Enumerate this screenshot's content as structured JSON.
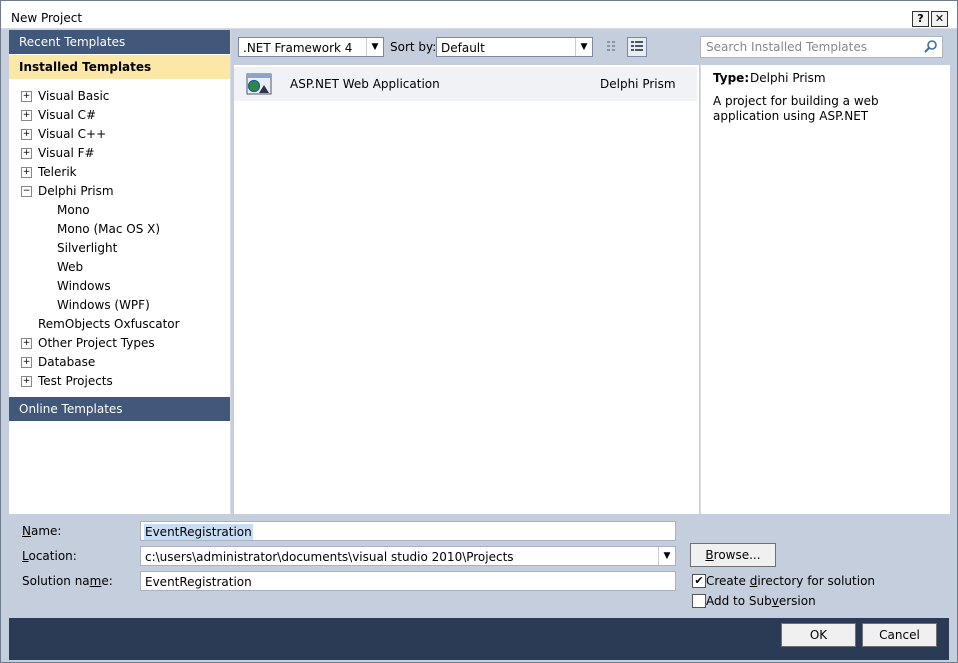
{
  "window": {
    "title": "New Project",
    "help_label": "?",
    "close_label": "✕"
  },
  "sidebar": {
    "recent_label": "Recent Templates",
    "installed_label": "Installed Templates",
    "online_label": "Online Templates",
    "items": [
      {
        "label": "Visual Basic",
        "expander": "+"
      },
      {
        "label": "Visual C#",
        "expander": "+"
      },
      {
        "label": "Visual C++",
        "expander": "+"
      },
      {
        "label": "Visual F#",
        "expander": "+"
      },
      {
        "label": "Telerik",
        "expander": "+"
      },
      {
        "label": "Delphi Prism",
        "expander": "−"
      },
      {
        "label": "Mono",
        "expander": ""
      },
      {
        "label": "Mono (Mac OS X)",
        "expander": ""
      },
      {
        "label": "Silverlight",
        "expander": ""
      },
      {
        "label": "Web",
        "expander": ""
      },
      {
        "label": "Windows",
        "expander": ""
      },
      {
        "label": "Windows (WPF)",
        "expander": ""
      },
      {
        "label": "RemObjects Oxfuscator",
        "expander": ""
      },
      {
        "label": "Other Project Types",
        "expander": "+"
      },
      {
        "label": "Database",
        "expander": "+"
      },
      {
        "label": "Test Projects",
        "expander": "+"
      }
    ]
  },
  "toolbar": {
    "framework_value": ".NET Framework 4",
    "sortby_label": "Sort by:",
    "sort_value": "Default",
    "search_placeholder": "Search Installed Templates"
  },
  "templates": [
    {
      "name": "ASP.NET Web Application",
      "language": "Delphi Prism"
    }
  ],
  "details": {
    "type_label": "Type:",
    "type_value": "Delphi Prism",
    "description": "A project for building a web application using ASP.NET"
  },
  "form": {
    "name_label": "Name:",
    "name_value": "EventRegistration",
    "location_label": "Location:",
    "location_value": "c:\\users\\administrator\\documents\\visual studio 2010\\Projects",
    "solution_label": "Solution name:",
    "solution_value": "EventRegistration",
    "browse_label": "Browse...",
    "create_dir_label": "Create directory for solution",
    "create_dir_checked": true,
    "subversion_label": "Add to Subversion",
    "subversion_checked": false
  },
  "buttons": {
    "ok_label": "OK",
    "cancel_label": "Cancel"
  },
  "colors": {
    "header_blue": "#41587a",
    "selected_yellow": "#fbe8a6",
    "footer": "#2b3a55",
    "panel": "#c4cedc"
  }
}
